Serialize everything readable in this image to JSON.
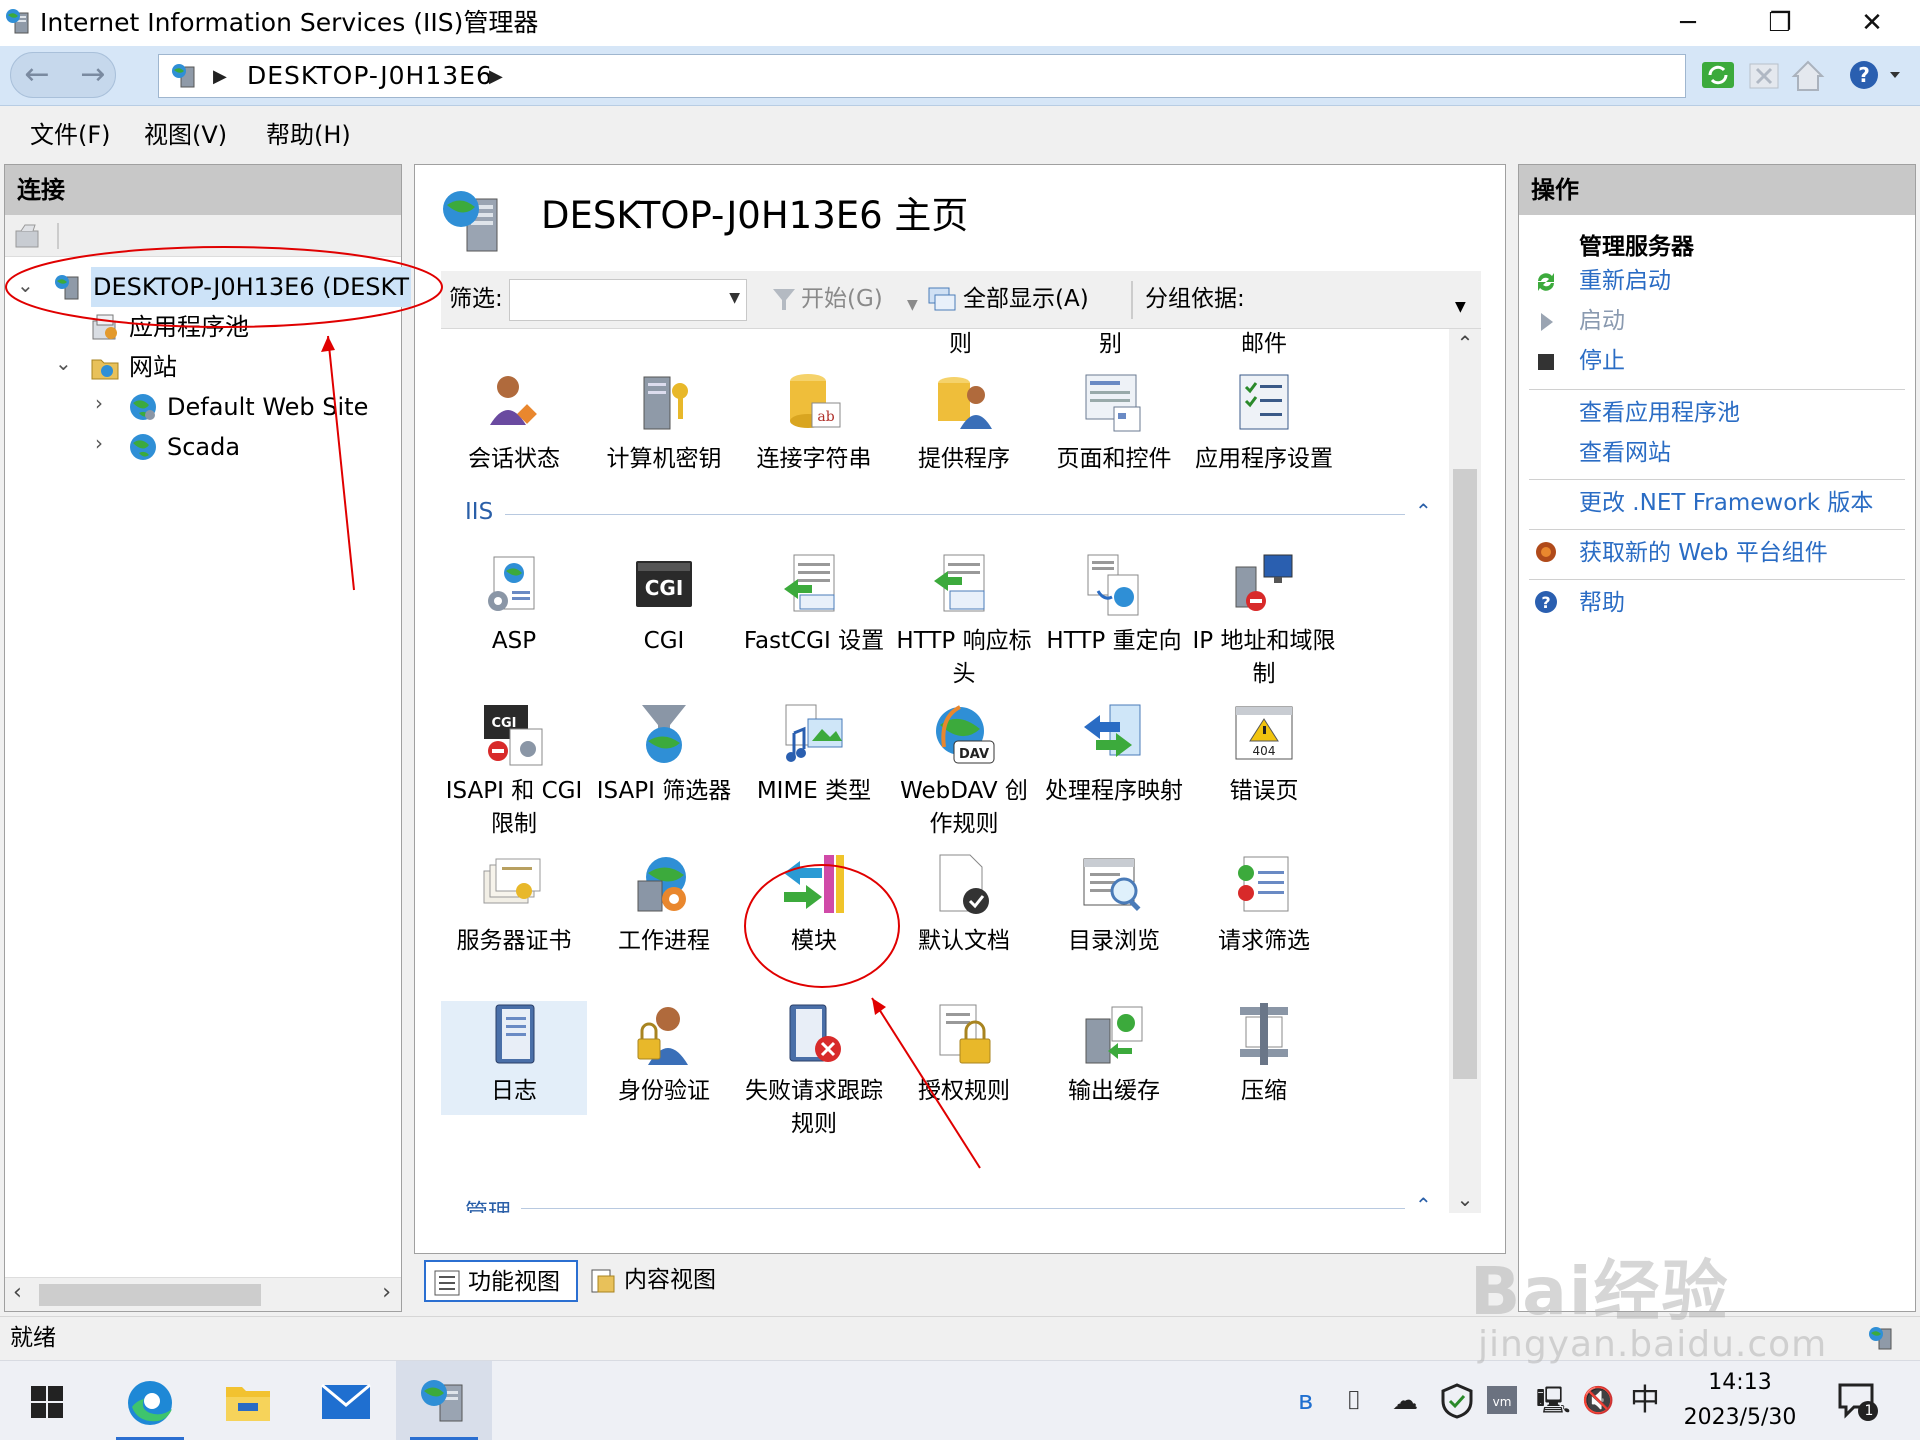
{
  "window": {
    "title": "Internet Information Services (IIS)管理器",
    "controls": [
      "─",
      "❐",
      "✕"
    ]
  },
  "address": {
    "path": "DESKTOP-J0H13E6"
  },
  "menu": [
    "文件(F)",
    "视图(V)",
    "帮助(H)"
  ],
  "connections": {
    "header": "连接",
    "tree": {
      "server": "DESKTOP-J0H13E6 (DESKT",
      "app_pools": "应用程序池",
      "sites": "网站",
      "site1": "Default Web Site",
      "site2": "Scada"
    }
  },
  "center": {
    "title": "DESKTOP-J0H13E6 主页",
    "filter_label": "筛选:",
    "start_label": "开始(G)",
    "showall_label": "全部显示(A)",
    "groupby_label": "分组依据:",
    "partial_labels": [
      "则",
      "别",
      "邮件"
    ],
    "aspnet_items": [
      "会话状态",
      "计算机密钥",
      "连接字符串",
      "提供程序",
      "页面和控件",
      "应用程序设置"
    ],
    "iis_group": "IIS",
    "iis_items": [
      "ASP",
      "CGI",
      "FastCGI 设置",
      "HTTP 响应标头",
      "HTTP 重定向",
      "IP 地址和域限制",
      "ISAPI 和 CGI 限制",
      "ISAPI 筛选器",
      "MIME 类型",
      "WebDAV 创作规则",
      "处理程序映射",
      "错误页",
      "服务器证书",
      "工作进程",
      "模块",
      "默认文档",
      "目录浏览",
      "请求筛选",
      "日志",
      "身份验证",
      "失败请求跟踪规则",
      "授权规则",
      "输出缓存",
      "压缩"
    ],
    "mgmt_group": "管理",
    "icon_text": {
      "cgi": "CGI",
      "dav": "DAV",
      "err": "404"
    }
  },
  "view_tabs": [
    "功能视图",
    "内容视图"
  ],
  "actions": {
    "header": "操作",
    "group": "管理服务器",
    "restart": "重新启动",
    "start": "启动",
    "stop": "停止",
    "view_pools": "查看应用程序池",
    "view_sites": "查看网站",
    "change_net": "更改 .NET Framework 版本",
    "get_web": "获取新的 Web 平台组件",
    "help": "帮助"
  },
  "status": "就绪",
  "taskbar": {
    "ime": "中",
    "time": "14:13",
    "date": "2023/5/30",
    "notif_count": "1"
  },
  "watermark": {
    "brand": "Bai经验",
    "url": "jingyan.baidu.com"
  },
  "colors": {
    "accent": "#2b6fd1",
    "link": "#2a6cc4",
    "annotation": "#e00000"
  }
}
